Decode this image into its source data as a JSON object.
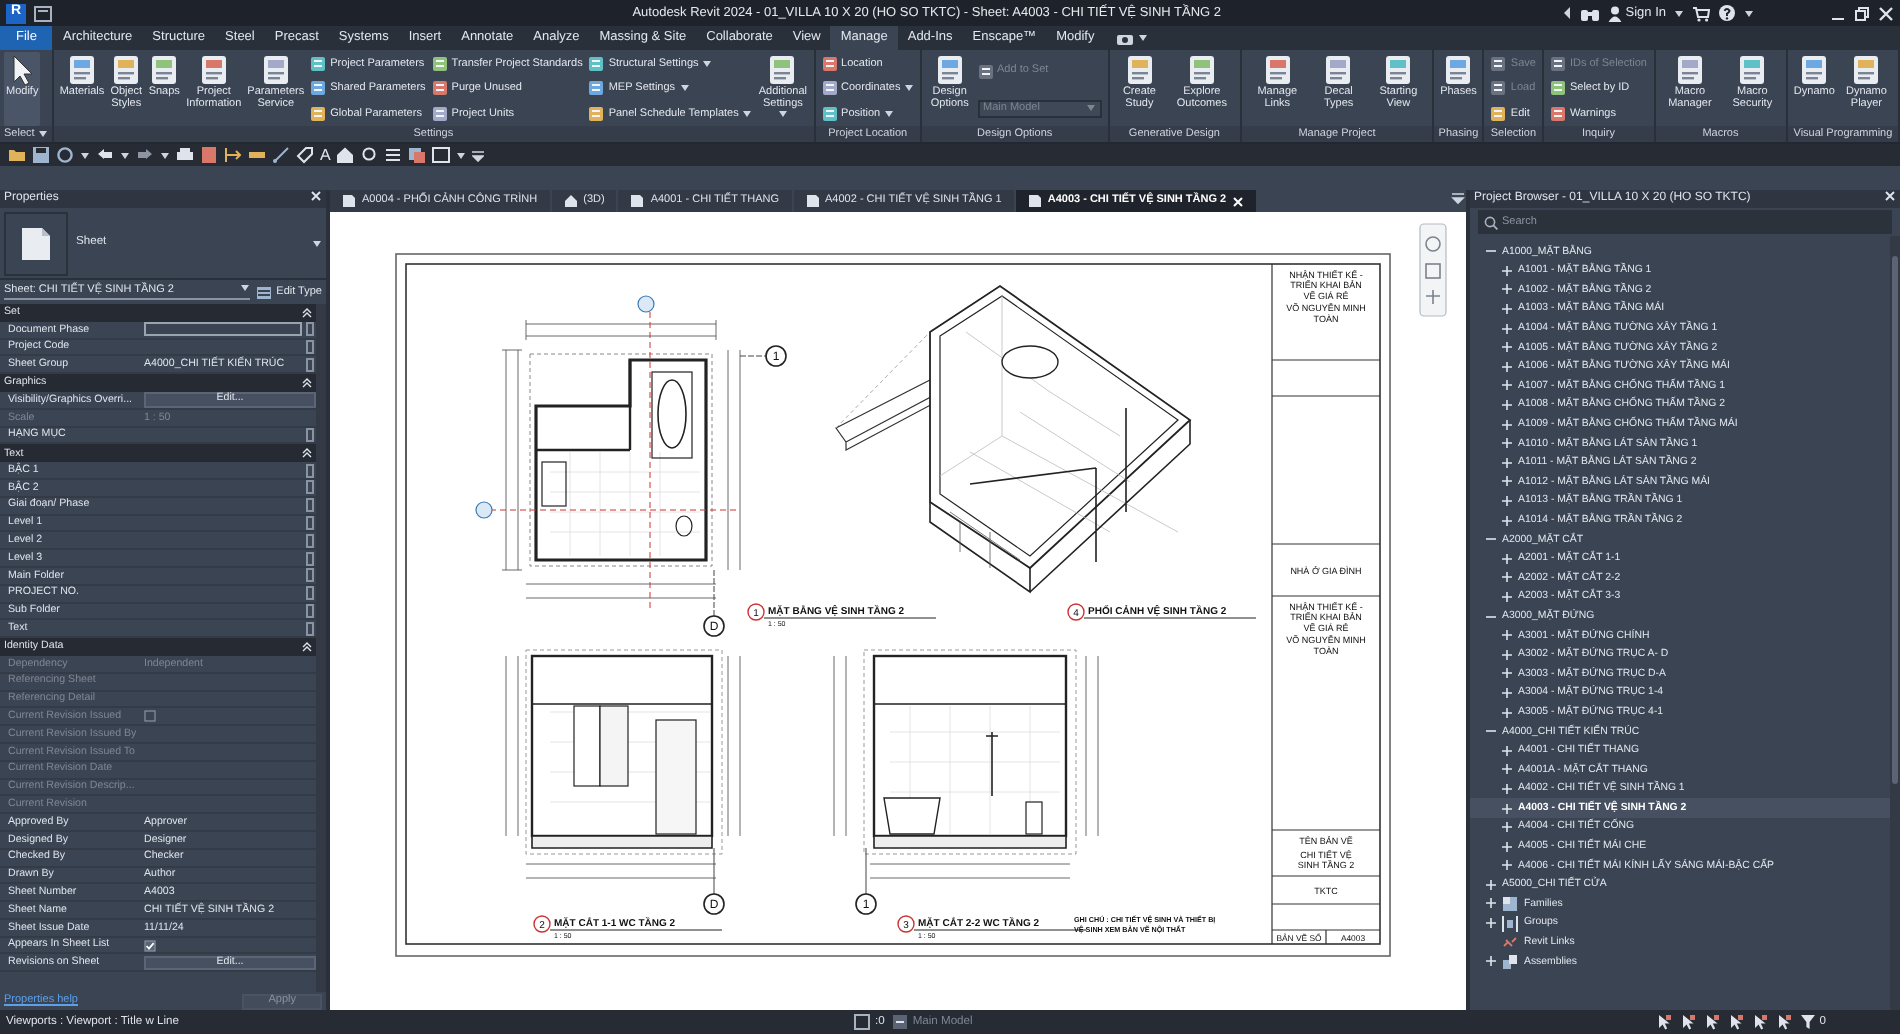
{
  "title_bar": {
    "logo": "R",
    "title": "Autodesk Revit 2024 - 01_VILLA 10 X 20 (HO SO TKTC) - Sheet: A4003 - CHI TIẾT VỆ SINH TẦNG 2",
    "sign_in": "Sign In"
  },
  "ribbon_tabs": [
    {
      "label": "File",
      "kind": "file",
      "selected": false
    },
    {
      "label": "Architecture",
      "kind": "tab",
      "selected": false
    },
    {
      "label": "Structure",
      "kind": "tab",
      "selected": false
    },
    {
      "label": "Steel",
      "kind": "tab",
      "selected": false
    },
    {
      "label": "Precast",
      "kind": "tab",
      "selected": false
    },
    {
      "label": "Systems",
      "kind": "tab",
      "selected": false
    },
    {
      "label": "Insert",
      "kind": "tab",
      "selected": false
    },
    {
      "label": "Annotate",
      "kind": "tab",
      "selected": false
    },
    {
      "label": "Analyze",
      "kind": "tab",
      "selected": false
    },
    {
      "label": "Massing & Site",
      "kind": "tab",
      "selected": false
    },
    {
      "label": "Collaborate",
      "kind": "tab",
      "selected": false
    },
    {
      "label": "View",
      "kind": "tab",
      "selected": false
    },
    {
      "label": "Manage",
      "kind": "tab",
      "selected": true
    },
    {
      "label": "Add-Ins",
      "kind": "tab",
      "selected": false
    },
    {
      "label": "Enscape™",
      "kind": "tab",
      "selected": false
    },
    {
      "label": "Modify",
      "kind": "tab",
      "selected": false
    }
  ],
  "ribbon_panels": [
    {
      "label": "Select",
      "dropdown": true,
      "columns": [
        {
          "kind": "large",
          "tools": [
            {
              "label": "Modify",
              "dropdown": false,
              "active": true
            }
          ]
        }
      ]
    },
    {
      "label": "Settings",
      "dropdown": false,
      "columns": [
        {
          "kind": "large",
          "tools": [
            {
              "label": "Materials",
              "dropdown": false,
              "active": false
            },
            {
              "label": "Object Styles",
              "dropdown": false,
              "active": false
            },
            {
              "label": "Snaps",
              "dropdown": false,
              "active": false
            },
            {
              "label": "Project Information",
              "dropdown": false,
              "active": false
            },
            {
              "label": "Parameters Service",
              "dropdown": false,
              "active": false
            }
          ]
        },
        {
          "kind": "small",
          "tools": [
            {
              "label": "Project Parameters",
              "kind": "button",
              "dropdown": false,
              "disabled": false
            },
            {
              "label": "Shared Parameters",
              "kind": "button",
              "dropdown": false,
              "disabled": false
            },
            {
              "label": "Global Parameters",
              "kind": "button",
              "dropdown": false,
              "disabled": false
            }
          ]
        },
        {
          "kind": "small",
          "tools": [
            {
              "label": "Transfer Project Standards",
              "kind": "button",
              "dropdown": false,
              "disabled": false
            },
            {
              "label": "Purge Unused",
              "kind": "button",
              "dropdown": false,
              "disabled": false
            },
            {
              "label": "Project Units",
              "kind": "button",
              "dropdown": false,
              "disabled": false
            }
          ]
        },
        {
          "kind": "small",
          "tools": [
            {
              "label": "Structural Settings",
              "kind": "button",
              "dropdown": true,
              "disabled": false
            },
            {
              "label": "MEP Settings",
              "kind": "button",
              "dropdown": true,
              "disabled": false
            },
            {
              "label": "Panel Schedule Templates",
              "kind": "button",
              "dropdown": true,
              "disabled": false
            }
          ]
        },
        {
          "kind": "large",
          "tools": [
            {
              "label": "Additional Settings",
              "dropdown": true,
              "active": false
            }
          ]
        }
      ]
    },
    {
      "label": "Project Location",
      "dropdown": false,
      "columns": [
        {
          "kind": "small",
          "tools": [
            {
              "label": "Location",
              "kind": "button",
              "dropdown": false,
              "disabled": false
            },
            {
              "label": "Coordinates",
              "kind": "button",
              "dropdown": true,
              "disabled": false
            },
            {
              "label": "Position",
              "kind": "button",
              "dropdown": true,
              "disabled": false
            }
          ]
        }
      ]
    },
    {
      "label": "Design Options",
      "dropdown": false,
      "columns": [
        {
          "kind": "large",
          "tools": [
            {
              "label": "Design Options",
              "dropdown": false,
              "active": false
            }
          ]
        },
        {
          "kind": "small",
          "tools": [
            {
              "label": "Add to Set",
              "kind": "button",
              "dropdown": false,
              "disabled": true
            },
            {
              "label": "Main Model",
              "kind": "combo",
              "dropdown": true,
              "disabled": true
            }
          ]
        }
      ]
    },
    {
      "label": "Generative Design",
      "dropdown": false,
      "columns": [
        {
          "kind": "large",
          "tools": [
            {
              "label": "Create Study",
              "dropdown": false,
              "active": false
            },
            {
              "label": "Explore Outcomes",
              "dropdown": false,
              "active": false
            }
          ]
        }
      ]
    },
    {
      "label": "Manage Project",
      "dropdown": false,
      "columns": [
        {
          "kind": "large",
          "tools": [
            {
              "label": "Manage Links",
              "dropdown": false,
              "active": false
            },
            {
              "label": "Decal Types",
              "dropdown": false,
              "active": false
            },
            {
              "label": "Starting View",
              "dropdown": false,
              "active": false
            }
          ]
        }
      ]
    },
    {
      "label": "Phasing",
      "dropdown": false,
      "columns": [
        {
          "kind": "large",
          "tools": [
            {
              "label": "Phases",
              "dropdown": false,
              "active": false
            }
          ]
        }
      ]
    },
    {
      "label": "Selection",
      "dropdown": false,
      "columns": [
        {
          "kind": "small",
          "tools": [
            {
              "label": "Save",
              "kind": "button",
              "dropdown": false,
              "disabled": true
            },
            {
              "label": "Load",
              "kind": "button",
              "dropdown": false,
              "disabled": true
            },
            {
              "label": "Edit",
              "kind": "button",
              "dropdown": false,
              "disabled": false
            }
          ]
        }
      ]
    },
    {
      "label": "Inquiry",
      "dropdown": false,
      "columns": [
        {
          "kind": "small",
          "tools": [
            {
              "label": "IDs of Selection",
              "kind": "button",
              "dropdown": false,
              "disabled": true
            },
            {
              "label": "Select by ID",
              "kind": "button",
              "dropdown": false,
              "disabled": false
            },
            {
              "label": "Warnings",
              "kind": "button",
              "dropdown": false,
              "disabled": false
            }
          ]
        }
      ]
    },
    {
      "label": "Macros",
      "dropdown": false,
      "columns": [
        {
          "kind": "large",
          "tools": [
            {
              "label": "Macro Manager",
              "dropdown": false,
              "active": false
            },
            {
              "label": "Macro Security",
              "dropdown": false,
              "active": false
            }
          ]
        }
      ]
    },
    {
      "label": "Visual Programming",
      "dropdown": false,
      "columns": [
        {
          "kind": "large",
          "tools": [
            {
              "label": "Dynamo",
              "dropdown": false,
              "active": false
            },
            {
              "label": "Dynamo Player",
              "dropdown": false,
              "active": false
            }
          ]
        }
      ]
    }
  ],
  "quick_access": {
    "text_tool": "A"
  },
  "properties": {
    "title": "Properties",
    "type_name": "Sheet",
    "instance": "Sheet: CHI TIẾT VỆ SINH TẦNG 2",
    "edit_type": "Edit Type",
    "groups": [
      {
        "label": "Set",
        "expanded": true,
        "rows": [
          {
            "label": "Document Phase",
            "kind": "field",
            "disabled": false,
            "param_button": true
          },
          {
            "label": "Project Code",
            "kind": "text",
            "disabled": false,
            "param_button": true
          },
          {
            "label": "Sheet Group",
            "value": "A4000_CHI TIẾT KIẾN TRÚC",
            "kind": "text",
            "disabled": false,
            "param_button": true
          }
        ]
      },
      {
        "label": "Graphics",
        "expanded": true,
        "rows": [
          {
            "label": "Visibility/Graphics Overri...",
            "value": "Edit...",
            "kind": "button",
            "disabled": false,
            "param_button": false
          },
          {
            "label": "Scale",
            "value": "1 : 50",
            "kind": "text",
            "disabled": true,
            "param_button": false
          },
          {
            "label": "HẠNG MỤC",
            "kind": "text",
            "disabled": false,
            "param_button": true
          }
        ]
      },
      {
        "label": "Text",
        "expanded": true,
        "rows": [
          {
            "label": "BẬC 1",
            "kind": "text",
            "disabled": false,
            "param_button": true
          },
          {
            "label": "BẬC 2",
            "kind": "text",
            "disabled": false,
            "param_button": true
          },
          {
            "label": "Giai đoạn/ Phase",
            "kind": "text",
            "disabled": false,
            "param_button": true
          },
          {
            "label": "Level 1",
            "kind": "text",
            "disabled": false,
            "param_button": true
          },
          {
            "label": "Level 2",
            "kind": "text",
            "disabled": false,
            "param_button": true
          },
          {
            "label": "Level 3",
            "kind": "text",
            "disabled": false,
            "param_button": true
          },
          {
            "label": "Main Folder",
            "kind": "text",
            "disabled": false,
            "param_button": true
          },
          {
            "label": "PROJECT NO.",
            "kind": "text",
            "disabled": false,
            "param_button": true
          },
          {
            "label": "Sub Folder",
            "kind": "text",
            "disabled": false,
            "param_button": true
          },
          {
            "label": "Text",
            "kind": "text",
            "disabled": false,
            "param_button": true
          }
        ]
      },
      {
        "label": "Identity Data",
        "expanded": true,
        "rows": [
          {
            "label": "Dependency",
            "value": "Independent",
            "kind": "text",
            "disabled": true,
            "param_button": false
          },
          {
            "label": "Referencing Sheet",
            "kind": "text",
            "disabled": true,
            "param_button": false
          },
          {
            "label": "Referencing Detail",
            "kind": "text",
            "disabled": true,
            "param_button": false
          },
          {
            "label": "Current Revision Issued",
            "kind": "check",
            "checked": false,
            "disabled": true,
            "param_button": false
          },
          {
            "label": "Current Revision Issued By",
            "kind": "text",
            "disabled": true,
            "param_button": false
          },
          {
            "label": "Current Revision Issued To",
            "kind": "text",
            "disabled": true,
            "param_button": false
          },
          {
            "label": "Current Revision Date",
            "kind": "text",
            "disabled": true,
            "param_button": false
          },
          {
            "label": "Current Revision Descrip...",
            "kind": "text",
            "disabled": true,
            "param_button": false
          },
          {
            "label": "Current Revision",
            "kind": "text",
            "disabled": true,
            "param_button": false
          },
          {
            "label": "Approved By",
            "value": "Approver",
            "kind": "text",
            "disabled": false,
            "param_button": false
          },
          {
            "label": "Designed By",
            "value": "Designer",
            "kind": "text",
            "disabled": false,
            "param_button": false
          },
          {
            "label": "Checked By",
            "value": "Checker",
            "kind": "text",
            "disabled": false,
            "param_button": false
          },
          {
            "label": "Drawn By",
            "value": "Author",
            "kind": "text",
            "disabled": false,
            "param_button": false
          },
          {
            "label": "Sheet Number",
            "value": "A4003",
            "kind": "text",
            "disabled": false,
            "param_button": false
          },
          {
            "label": "Sheet Name",
            "value": "CHI TIẾT VỆ SINH TẦNG 2",
            "kind": "text",
            "disabled": false,
            "param_button": false
          },
          {
            "label": "Sheet Issue Date",
            "value": "11/11/24",
            "kind": "text",
            "disabled": false,
            "param_button": false
          },
          {
            "label": "Appears In Sheet List",
            "kind": "check",
            "checked": true,
            "disabled": false,
            "param_button": false
          },
          {
            "label": "Revisions on Sheet",
            "value": "Edit...",
            "kind": "button",
            "disabled": false,
            "param_button": false
          }
        ]
      }
    ],
    "help": "Properties help",
    "apply": "Apply"
  },
  "view_tabs": [
    {
      "label": "A0004 - PHỐI CẢNH CÔNG TRÌNH",
      "kind": "sheet",
      "selected": false
    },
    {
      "label": "(3D)",
      "kind": "model",
      "selected": false
    },
    {
      "label": "A4001 - CHI TIẾT THANG",
      "kind": "sheet",
      "selected": false
    },
    {
      "label": "A4002 - CHI TIẾT VỆ SINH TẦNG 1",
      "kind": "sheet",
      "selected": false
    },
    {
      "label": "A4003 - CHI TIẾT VỆ SINH TẦNG 2",
      "kind": "sheet",
      "selected": true
    }
  ],
  "sheet": {
    "views": [
      {
        "number": "1",
        "title": "MẶT BẰNG VỆ SINH TẦNG 2",
        "scale": "1 : 50",
        "kind": "plan",
        "grid_labels": [
          "1",
          "D"
        ]
      },
      {
        "number": "4",
        "title": "PHỐI CẢNH VỆ SINH TẦNG 2",
        "kind": "iso"
      },
      {
        "number": "2",
        "title": "MẶT CẮT 1-1 WC TẦNG 2",
        "scale": "1 : 50",
        "kind": "section_a",
        "grid_labels": [
          "D"
        ]
      },
      {
        "number": "3",
        "title": "MẶT CẮT 2-2 WC TẦNG 2",
        "scale": "1 : 50",
        "kind": "section_b",
        "grid_labels": [
          "1"
        ]
      }
    ],
    "note_lines": [
      "GHI CHÚ : CHI TIẾT VỆ SINH VÀ THIẾT BỊ",
      "VỆ SINH XEM BẢN VẼ NỘI THẤT"
    ],
    "title_block": {
      "top_text": "NHẬN THIẾT KẾ - TRIỂN KHAI BẢN VẼ GIÁ RẺ",
      "top_designer": "VÕ NGUYỄN MINH TOÀN",
      "project": "NHÀ Ở GIA ĐÌNH",
      "middle_text": "NHẬN THIẾT KẾ - TRIỂN KHAI BẢN VẼ GIÁ RẺ",
      "middle_designer": "VÕ NGUYỄN MINH TOÀN",
      "name_label": "TÊN BẢN VẼ",
      "name": "CHI TIẾT VỆ SINH TẦNG 2",
      "stage": "TKTC",
      "number_label": "BẢN VẼ SỐ",
      "number": "A4003"
    }
  },
  "project_browser": {
    "title": "Project Browser - 01_VILLA 10 X 20 (HO SO TKTC)",
    "search_placeholder": "Search",
    "items": [
      {
        "label": "A1000_MẶT BẰNG",
        "kind": "folder",
        "expanded": true,
        "selected": false,
        "children": [
          {
            "label": "A1001 - MẶT BẰNG TẦNG 1",
            "expanded": false,
            "selected": false
          },
          {
            "label": "A1002 - MẶT BẰNG TẦNG 2",
            "expanded": false,
            "selected": false
          },
          {
            "label": "A1003 - MẶT BẰNG TẦNG MÁI",
            "expanded": false,
            "selected": false
          },
          {
            "label": "A1004 - MẶT BẰNG TƯỜNG XÂY TẦNG 1",
            "expanded": false,
            "selected": false
          },
          {
            "label": "A1005 - MẶT BẰNG TƯỜNG XÂY TẦNG 2",
            "expanded": false,
            "selected": false
          },
          {
            "label": "A1006 - MẶT BẰNG TƯỜNG XÂY TẦNG MÁI",
            "expanded": false,
            "selected": false
          },
          {
            "label": "A1007 - MẶT BẰNG CHỐNG THẤM TẦNG 1",
            "expanded": false,
            "selected": false
          },
          {
            "label": "A1008 - MẶT BẰNG CHỐNG THẤM TẦNG 2",
            "expanded": false,
            "selected": false
          },
          {
            "label": "A1009 - MẶT BẰNG CHỐNG THẤM TẦNG MÁI",
            "expanded": false,
            "selected": false
          },
          {
            "label": "A1010 - MẶT BẰNG LÁT SÀN TẦNG 1",
            "expanded": false,
            "selected": false
          },
          {
            "label": "A1011 - MẶT BẰNG LÁT SÀN TẦNG 2",
            "expanded": false,
            "selected": false
          },
          {
            "label": "A1012 - MẶT BẰNG LÁT SÀN TẦNG MÁI",
            "expanded": false,
            "selected": false
          },
          {
            "label": "A1013 - MẶT BẰNG TRẦN TẦNG 1",
            "expanded": false,
            "selected": false
          },
          {
            "label": "A1014 - MẶT BẰNG TRẦN TẦNG 2",
            "expanded": false,
            "selected": false
          }
        ]
      },
      {
        "label": "A2000_MẶT CẮT",
        "kind": "folder",
        "expanded": true,
        "selected": false,
        "children": [
          {
            "label": "A2001 - MẶT CẮT 1-1",
            "expanded": false,
            "selected": false
          },
          {
            "label": "A2002 - MẶT CẮT 2-2",
            "expanded": false,
            "selected": false
          },
          {
            "label": "A2003 - MẶT CẮT 3-3",
            "expanded": false,
            "selected": false
          }
        ]
      },
      {
        "label": "A3000_MẶT ĐỨNG",
        "kind": "folder",
        "expanded": true,
        "selected": false,
        "children": [
          {
            "label": "A3001 - MẶT ĐỨNG CHÍNH",
            "expanded": false,
            "selected": false
          },
          {
            "label": "A3002 - MẶT ĐỨNG TRỤC A- D",
            "expanded": false,
            "selected": false
          },
          {
            "label": "A3003 - MẶT ĐỨNG TRỤC D-A",
            "expanded": false,
            "selected": false
          },
          {
            "label": "A3004 - MẶT ĐỨNG TRỤC 1-4",
            "expanded": false,
            "selected": false
          },
          {
            "label": "A3005 - MẶT ĐỨNG TRỤC 4-1",
            "expanded": false,
            "selected": false
          }
        ]
      },
      {
        "label": "A4000_CHI TIẾT KIẾN TRÚC",
        "kind": "folder",
        "expanded": true,
        "selected": false,
        "children": [
          {
            "label": "A4001 - CHI TIẾT THANG",
            "expanded": false,
            "selected": false
          },
          {
            "label": "A4001A - MẶT CẮT THANG",
            "expanded": false,
            "selected": false
          },
          {
            "label": "A4002 - CHI TIẾT VỆ SINH TẦNG 1",
            "expanded": false,
            "selected": false
          },
          {
            "label": "A4003 - CHI TIẾT VỆ SINH TẦNG 2",
            "expanded": false,
            "selected": true
          },
          {
            "label": "A4004 - CHI TIẾT CỐNG",
            "expanded": false,
            "selected": false
          },
          {
            "label": "A4005 - CHI TIẾT MÁI CHE",
            "expanded": false,
            "selected": false
          },
          {
            "label": "A4006 - CHI TIẾT MÁI KÍNH LẤY SÁNG MÁI-BẬC CẤP",
            "expanded": false,
            "selected": false
          }
        ]
      },
      {
        "label": "A5000_CHI TIẾT CỬA",
        "kind": "folder",
        "expanded": false,
        "selected": false
      },
      {
        "label": "Families",
        "kind": "families",
        "expanded": false,
        "selected": false
      },
      {
        "label": "Groups",
        "kind": "groups",
        "expanded": false,
        "selected": false
      },
      {
        "label": "Revit Links",
        "kind": "links",
        "selected": false
      },
      {
        "label": "Assemblies",
        "kind": "assemblies",
        "expanded": false,
        "selected": false
      }
    ]
  },
  "status_bar": {
    "text": "Viewports : Viewport : Title w Line",
    "workset_count": ":0",
    "design_option": "Main Model",
    "filter_count": "0"
  }
}
